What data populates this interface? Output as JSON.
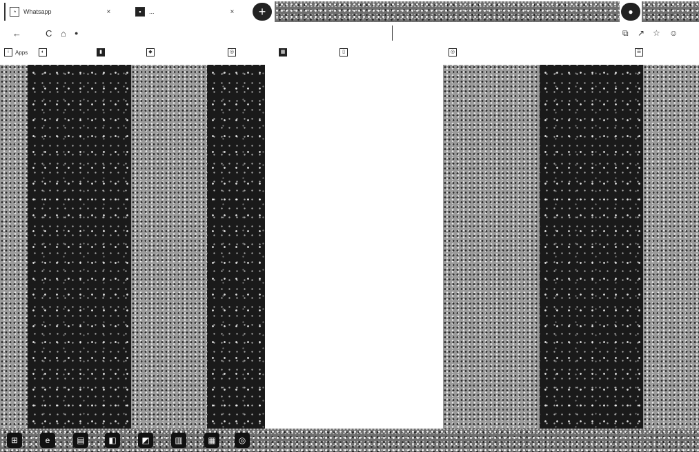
{
  "tabs": [
    {
      "label": "Whatsapp",
      "close": "×",
      "icon": "whatsapp-icon"
    },
    {
      "label": "...",
      "close": "×",
      "icon": "page-icon"
    }
  ],
  "newtab": {
    "label": "+"
  },
  "nav": {
    "back": "←",
    "reload": "C",
    "home": "⌂"
  },
  "address": {
    "url": ""
  },
  "toolbar_right": {
    "extensions": "⧉",
    "share": "↗",
    "favorite": "☆",
    "profile": "☺"
  },
  "bookmarks": [
    {
      "label": "Apps",
      "icon": "apps-icon"
    },
    {
      "label": "",
      "icon": "bookmark-icon"
    },
    {
      "label": "",
      "icon": "bookmark-icon"
    },
    {
      "label": "",
      "icon": "bookmark-icon"
    },
    {
      "label": "",
      "icon": "bookmark-icon"
    },
    {
      "label": "",
      "icon": "bookmark-icon"
    },
    {
      "label": "",
      "icon": "bookmark-icon"
    },
    {
      "label": "",
      "icon": "bookmark-icon"
    }
  ],
  "reading_list": {
    "label": ""
  },
  "table": {
    "rows": [
      {
        "c1": "",
        "c2": "",
        "c3": "",
        "c4": ""
      },
      {
        "c1": "",
        "c2": "",
        "c3": "",
        "c4": ""
      },
      {
        "c1": "",
        "c2": "",
        "c3": "",
        "c4": ""
      },
      {
        "c1": "",
        "c2": "",
        "c3": "",
        "c4": ""
      },
      {
        "c1": "",
        "c2": "",
        "c3": "",
        "c4": ""
      },
      {
        "c1": "",
        "c2": "",
        "c3": "",
        "c4": ""
      },
      {
        "c1": "",
        "c2": "",
        "c3": "",
        "c4": ""
      },
      {
        "c1": "",
        "c2": "",
        "c3": "",
        "c4": ""
      },
      {
        "c1": "",
        "c2": "",
        "c3": "",
        "c4": ""
      },
      {
        "c1": "",
        "c2": "",
        "c3": "",
        "c4": ""
      },
      {
        "c1": "",
        "c2": "",
        "c3": "",
        "c4": ""
      },
      {
        "c1": "",
        "c2": "",
        "c3": "",
        "c4": ""
      },
      {
        "c1": "",
        "c2": "",
        "c3": "",
        "c4": ""
      },
      {
        "c1": "",
        "c2": "",
        "c3": "",
        "c4": ""
      },
      {
        "c1": "",
        "c2": "",
        "c3": "",
        "c4": ""
      }
    ],
    "footer1": "",
    "footer2": ""
  },
  "taskbar": [
    {
      "label": "⊞",
      "icon": "start-icon"
    },
    {
      "label": "e",
      "icon": "browser-icon"
    },
    {
      "label": "▤",
      "icon": "folder-icon"
    },
    {
      "label": "◧",
      "icon": "app-icon"
    },
    {
      "label": "◩",
      "icon": "app-icon"
    },
    {
      "label": "▥",
      "icon": "app-icon"
    },
    {
      "label": "▦",
      "icon": "app-icon"
    },
    {
      "label": "◎",
      "icon": "chrome-icon"
    }
  ]
}
